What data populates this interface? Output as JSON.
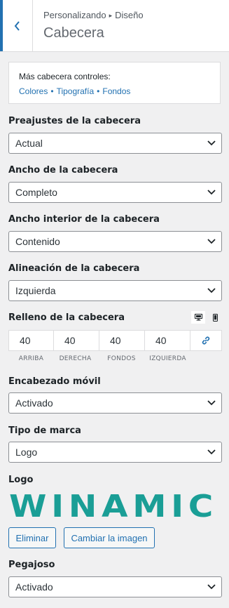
{
  "header": {
    "breadcrumb_parent": "Personalizando",
    "breadcrumb_child": "Diseño",
    "title": "Cabecera"
  },
  "info": {
    "intro": "Más cabecera controles:",
    "links": [
      "Colores",
      "Tipografía",
      "Fondos"
    ]
  },
  "fields": {
    "preset": {
      "label": "Preajustes de la cabecera",
      "value": "Actual"
    },
    "width": {
      "label": "Ancho de la cabecera",
      "value": "Completo"
    },
    "inner_width": {
      "label": "Ancho interior de la cabecera",
      "value": "Contenido"
    },
    "alignment": {
      "label": "Alineación de la cabecera",
      "value": "Izquierda"
    },
    "padding": {
      "label": "Relleno de la cabecera",
      "values": [
        "40",
        "40",
        "40",
        "40"
      ],
      "sides": [
        "ARRIBA",
        "DERECHA",
        "FONDOS",
        "IZQUIERDA"
      ]
    },
    "mobile_header": {
      "label": "Encabezado móvil",
      "value": "Activado"
    },
    "brand_type": {
      "label": "Tipo de marca",
      "value": "Logo"
    },
    "logo": {
      "label": "Logo",
      "image_text": "WINAMIC",
      "remove_label": "Eliminar",
      "change_label": "Cambiar la imagen"
    },
    "sticky": {
      "label": "Pegajoso",
      "value": "Activado"
    }
  },
  "colors": {
    "accent": "#2271b1",
    "logo": "#1a9e96"
  },
  "icons": [
    "chevron-left-icon",
    "chevron-down-icon",
    "desktop-icon",
    "mobile-icon",
    "link-icon"
  ]
}
